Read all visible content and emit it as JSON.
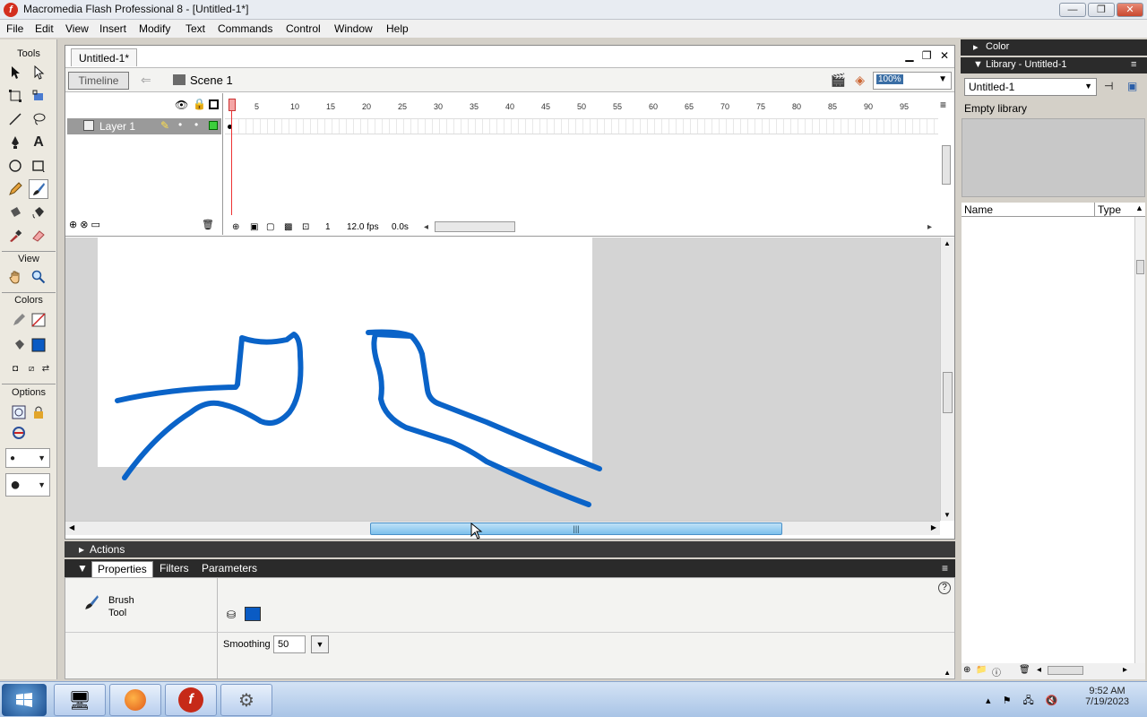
{
  "window": {
    "title": "Macromedia Flash Professional 8 - [Untitled-1*]",
    "app_icon": "f",
    "buttons": {
      "minimize": "—",
      "restore": "❐",
      "close": "✕"
    }
  },
  "menu": [
    "File",
    "Edit",
    "View",
    "Insert",
    "Modify",
    "Text",
    "Commands",
    "Control",
    "Window",
    "Help"
  ],
  "tools": {
    "title": "Tools",
    "view_label": "View",
    "colors_label": "Colors",
    "options_label": "Options",
    "active_tool": "brush",
    "stroke_color": "#cc2222",
    "fill_color": "#0a5bc4"
  },
  "document": {
    "tab": "Untitled-1*",
    "timeline_button": "Timeline",
    "scene": "Scene 1",
    "zoom": "100%"
  },
  "timeline": {
    "layer_name": "Layer 1",
    "ruler": [
      "1",
      "5",
      "10",
      "15",
      "20",
      "25",
      "30",
      "35",
      "40",
      "45",
      "50",
      "55",
      "60",
      "65",
      "70",
      "75",
      "80",
      "85",
      "90",
      "95"
    ],
    "current_frame": "1",
    "fps": "12.0 fps",
    "time": "0.0s"
  },
  "stage": {
    "stroke_color": "#0a63c8"
  },
  "panels": {
    "actions": "Actions",
    "properties_tab": "Properties",
    "filters_tab": "Filters",
    "parameters_tab": "Parameters",
    "tool_name_line1": "Brush",
    "tool_name_line2": "Tool",
    "smoothing_label": "Smoothing",
    "smoothing_value": "50",
    "help": "?"
  },
  "right": {
    "color_panel": "Color",
    "library_panel": "Library - Untitled-1",
    "library_select": "Untitled-1",
    "library_status": "Empty library",
    "col_name": "Name",
    "col_type": "Type"
  },
  "taskbar": {
    "time": "9:52 AM",
    "date": "7/19/2023"
  }
}
